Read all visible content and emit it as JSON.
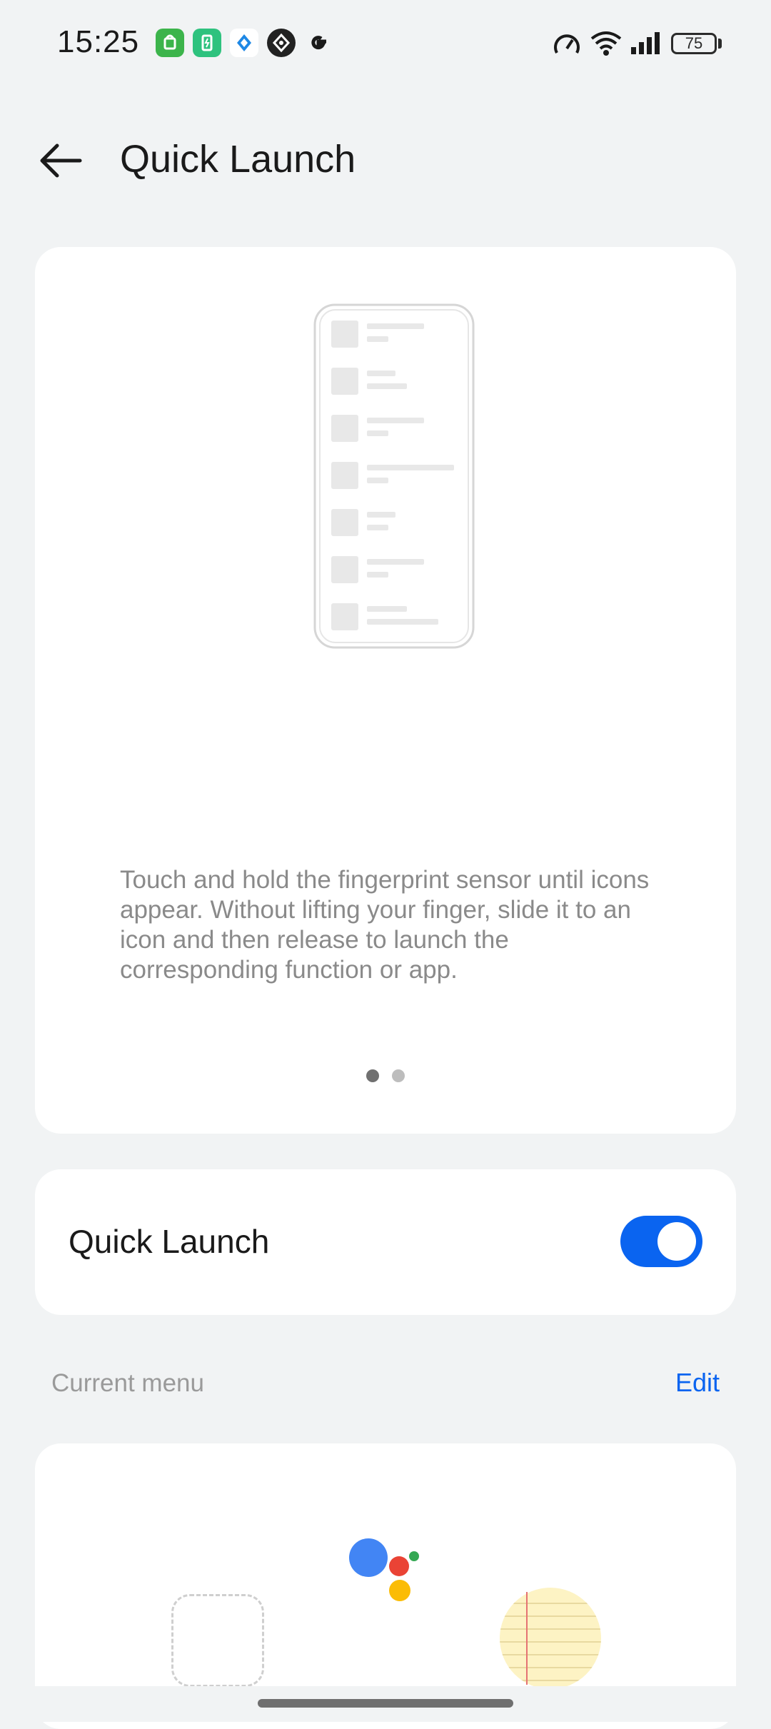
{
  "status_bar": {
    "time": "15:25",
    "battery_level": "75",
    "notification_icons": [
      "app-store-icon",
      "battery-saver-icon",
      "blue-app-icon",
      "compass-app-icon",
      "google-icon"
    ],
    "system_icons": [
      "speed-meter-icon",
      "wifi-icon",
      "signal-icon",
      "battery-icon"
    ]
  },
  "header": {
    "title": "Quick Launch"
  },
  "intro_card": {
    "description": "Touch and hold the fingerprint sensor until icons appear. Without lifting your finger, slide it to an icon and then release to launch the corresponding function or app.",
    "page_count": 2,
    "current_page": 1
  },
  "toggle": {
    "label": "Quick Launch",
    "enabled": true
  },
  "menu_section": {
    "label": "Current menu",
    "edit_label": "Edit"
  },
  "menu_items": [
    "empty-slot",
    "google-assistant-icon",
    "notes-icon"
  ],
  "colors": {
    "accent": "#0a64f0",
    "background": "#f1f3f4",
    "card": "#ffffff",
    "google_blue": "#4285f4",
    "google_red": "#ea4335",
    "google_yellow": "#fbbc05",
    "google_green": "#34a853"
  }
}
